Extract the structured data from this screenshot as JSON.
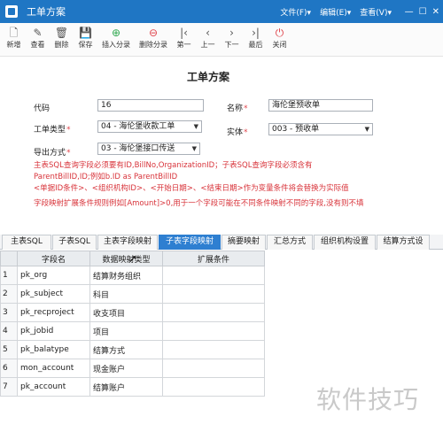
{
  "window": {
    "title": "工单方案",
    "menus": [
      "文件(F)▾",
      "编辑(E)▾",
      "查看(V)▾"
    ],
    "controls": [
      "—",
      "☐",
      "✕"
    ]
  },
  "toolbar": [
    {
      "label": "新增",
      "icon": "new-doc-icon",
      "glyph": "🗋"
    },
    {
      "label": "查看",
      "icon": "edit-icon",
      "glyph": "✎"
    },
    {
      "label": "删除",
      "icon": "trash-icon",
      "glyph": "🗑"
    },
    {
      "label": "保存",
      "icon": "save-icon",
      "glyph": "💾"
    },
    {
      "label": "插入分录",
      "icon": "plus-circle-icon",
      "glyph": "⊕"
    },
    {
      "label": "删除分录",
      "icon": "minus-circle-icon",
      "glyph": "⊖"
    },
    {
      "label": "第一",
      "icon": "first-icon",
      "glyph": "|‹"
    },
    {
      "label": "上一",
      "icon": "prev-icon",
      "glyph": "‹"
    },
    {
      "label": "下一",
      "icon": "next-icon",
      "glyph": "›"
    },
    {
      "label": "最后",
      "icon": "last-icon",
      "glyph": "›|"
    },
    {
      "label": "关闭",
      "icon": "power-icon",
      "glyph": "⏻"
    }
  ],
  "form": {
    "title": "工单方案",
    "code_label": "代码",
    "code_value": "16",
    "name_label": "名称",
    "name_value": "海伦堡预收单",
    "type_label": "工单类型",
    "type_value": "04 - 海伦堡收款工单",
    "entity_label": "实体",
    "entity_value": "003 - 预收单",
    "export_label": "导出方式",
    "export_value": "03 - 海伦堡接口传送"
  },
  "notes": [
    "主表SQL查询字段必须要有ID,BillNo,OrganizationID；子表SQL查询字段必须含有",
    "ParentBillID,ID;例如b.ID as ParentBillID",
    "<单据ID条件>、<组织机构ID>、<开始日期>、<结束日期>作为变量条件将会替换为实际值",
    "字段映射扩展条件规则例如[Amount]>0,用于一个字段可能在不同条件映射不同的字段,没有则不填"
  ],
  "tabs": [
    "主表SQL",
    "子表SQL",
    "主表字段映射",
    "子表字段映射",
    "摘要映射",
    "汇总方式",
    "组织机构设置",
    "结算方式设"
  ],
  "active_tab": "子表字段映射",
  "grid": {
    "headers": [
      "",
      "字段名",
      "数据映射类型",
      "扩展条件"
    ],
    "rows": [
      {
        "num": "1",
        "field": "pk_org",
        "type": "结算财务组织",
        "ext": ""
      },
      {
        "num": "2",
        "field": "pk_subject",
        "type": "科目",
        "ext": ""
      },
      {
        "num": "3",
        "field": "pk_recproject",
        "type": "收支项目",
        "ext": ""
      },
      {
        "num": "4",
        "field": "pk_jobid",
        "type": "项目",
        "ext": ""
      },
      {
        "num": "5",
        "field": "pk_balatype",
        "type": "结算方式",
        "ext": ""
      },
      {
        "num": "6",
        "field": "mon_account",
        "type": "现金账户",
        "ext": ""
      },
      {
        "num": "7",
        "field": "pk_account",
        "type": "结算账户",
        "ext": ""
      }
    ]
  },
  "watermark": "软件技巧",
  "colors": {
    "titlebar": "#1f76c4",
    "active_tab": "#2e7fd1",
    "note_red": "#d8333a"
  }
}
